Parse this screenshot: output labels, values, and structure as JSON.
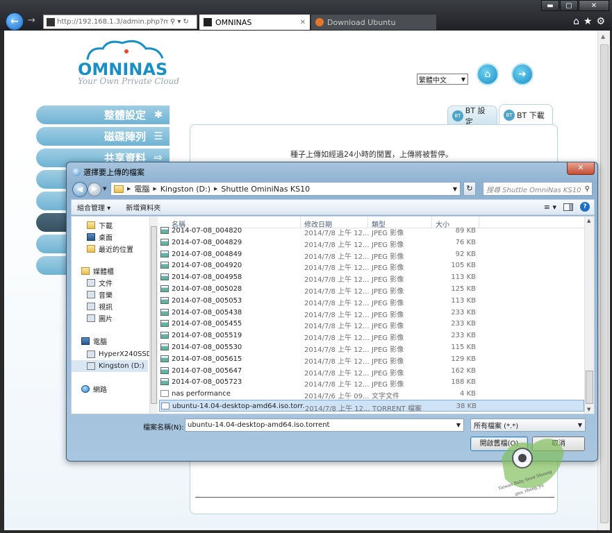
{
  "browser": {
    "address": "http://192.168.1.3/admin.php?me",
    "tabs": [
      {
        "label": "OMNINAS",
        "active": true
      },
      {
        "label": "Download Ubuntu",
        "active": false
      }
    ],
    "window_buttons": [
      "▬",
      "▢",
      "✕"
    ],
    "toolbar_icons": [
      "home-icon",
      "star-icon",
      "gear-icon"
    ]
  },
  "page": {
    "logo_text": "OMNINAS",
    "logo_tagline": "Your Own Private Cloud",
    "language": "繁體中文",
    "side_menu": [
      {
        "label": "整體設定",
        "icon": "tools-icon"
      },
      {
        "label": "磁碟陣列",
        "icon": "disk-icon"
      },
      {
        "label": "共享資料",
        "icon": "share-icon"
      },
      {
        "label": "",
        "icon": ""
      },
      {
        "label": "",
        "icon": ""
      },
      {
        "label": "",
        "icon": ""
      },
      {
        "label": "",
        "icon": ""
      },
      {
        "label": "",
        "icon": ""
      }
    ],
    "bt_tabs": [
      {
        "label": "BT 設定",
        "icon_text": "BT"
      },
      {
        "label": "BT 下載",
        "icon_text": "BT"
      }
    ],
    "bt_note": "種子上傳如經過24小時的閒置，上傳將被暫停。"
  },
  "dialog": {
    "title": "選擇要上傳的檔案",
    "breadcrumb": [
      "電腦",
      "Kingston (D:)",
      "Shuttle OminiNas KS10"
    ],
    "search_placeholder": "搜尋 Shuttle OmniNas KS10",
    "toolbar": {
      "organize": "組合管理 ▾",
      "new_folder": "新增資料夾"
    },
    "nav": [
      {
        "label": "下載",
        "icon": "download-folder-icon",
        "kind": "fold"
      },
      {
        "label": "桌面",
        "icon": "desktop-icon",
        "kind": "pc"
      },
      {
        "label": "最近的位置",
        "icon": "recent-places-icon",
        "kind": "fold"
      },
      {
        "label": "媒體櫃",
        "icon": "libraries-icon",
        "kind": "fold"
      },
      {
        "label": "文件",
        "icon": "documents-icon",
        "kind": "plain"
      },
      {
        "label": "音樂",
        "icon": "music-icon",
        "kind": "plain"
      },
      {
        "label": "視訊",
        "icon": "video-icon",
        "kind": "plain"
      },
      {
        "label": "圖片",
        "icon": "pictures-icon",
        "kind": "plain"
      },
      {
        "label": "電腦",
        "icon": "computer-icon",
        "kind": "pc"
      },
      {
        "label": "HyperX240SSD",
        "icon": "drive-icon",
        "kind": "plain"
      },
      {
        "label": "Kingston (D:)",
        "icon": "drive-icon",
        "kind": "plain"
      },
      {
        "label": "網路",
        "icon": "network-icon",
        "kind": "net"
      }
    ],
    "columns": {
      "name": "名稱",
      "date": "修改日期",
      "type": "類型",
      "size": "大小"
    },
    "files": [
      {
        "name": "2014-07-08_004820",
        "date": "2014/7/8 上午 12...",
        "type": "JPEG 影像",
        "size": "89 KB",
        "icon": "image"
      },
      {
        "name": "2014-07-08_004829",
        "date": "2014/7/8 上午 12...",
        "type": "JPEG 影像",
        "size": "76 KB",
        "icon": "image"
      },
      {
        "name": "2014-07-08_004849",
        "date": "2014/7/8 上午 12...",
        "type": "JPEG 影像",
        "size": "92 KB",
        "icon": "image"
      },
      {
        "name": "2014-07-08_004920",
        "date": "2014/7/8 上午 12...",
        "type": "JPEG 影像",
        "size": "105 KB",
        "icon": "image"
      },
      {
        "name": "2014-07-08_004958",
        "date": "2014/7/8 上午 12...",
        "type": "JPEG 影像",
        "size": "113 KB",
        "icon": "image"
      },
      {
        "name": "2014-07-08_005028",
        "date": "2014/7/8 上午 12...",
        "type": "JPEG 影像",
        "size": "125 KB",
        "icon": "image"
      },
      {
        "name": "2014-07-08_005053",
        "date": "2014/7/8 上午 12...",
        "type": "JPEG 影像",
        "size": "113 KB",
        "icon": "image"
      },
      {
        "name": "2014-07-08_005438",
        "date": "2014/7/8 上午 12...",
        "type": "JPEG 影像",
        "size": "233 KB",
        "icon": "image"
      },
      {
        "name": "2014-07-08_005455",
        "date": "2014/7/8 上午 12...",
        "type": "JPEG 影像",
        "size": "233 KB",
        "icon": "image"
      },
      {
        "name": "2014-07-08_005519",
        "date": "2014/7/8 上午 12...",
        "type": "JPEG 影像",
        "size": "233 KB",
        "icon": "image"
      },
      {
        "name": "2014-07-08_005530",
        "date": "2014/7/8 上午 12...",
        "type": "JPEG 影像",
        "size": "115 KB",
        "icon": "image"
      },
      {
        "name": "2014-07-08_005615",
        "date": "2014/7/8 上午 12...",
        "type": "JPEG 影像",
        "size": "129 KB",
        "icon": "image"
      },
      {
        "name": "2014-07-08_005647",
        "date": "2014/7/8 上午 12...",
        "type": "JPEG 影像",
        "size": "162 KB",
        "icon": "image"
      },
      {
        "name": "2014-07-08_005723",
        "date": "2014/7/8 上午 12...",
        "type": "JPEG 影像",
        "size": "188 KB",
        "icon": "image"
      },
      {
        "name": "nas performance",
        "date": "2014/7/6 上午 09...",
        "type": "文字文件",
        "size": "4 KB",
        "icon": "txt"
      },
      {
        "name": "ubuntu-14.04-desktop-amd64.iso.torr...",
        "date": "2014/7/8 上午 12...",
        "type": "TORRENT 檔案",
        "size": "38 KB",
        "icon": "tor",
        "selected": true
      }
    ],
    "filename_label": "檔案名稱(N):",
    "filename_value": "ubuntu-14.04-desktop-amd64.iso.torrent",
    "filter": "所有檔案 (*.*)",
    "open_button": "開啟舊檔(O)",
    "cancel_button": "取消"
  },
  "watermark": {
    "line1": "Taiwan Baby Seed Shuang",
    "line2": "gnu_zhang_yu"
  }
}
